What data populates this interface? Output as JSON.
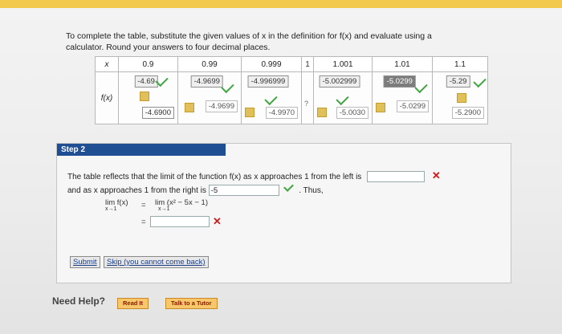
{
  "intro_line1": "To complete the table, substitute the given values of x in the definition for f(x) and evaluate using a",
  "intro_line2": "calculator. Round your answers to four decimal places.",
  "table": {
    "x_label": "x",
    "fx_label": "f(x)",
    "x_values": [
      "0.9",
      "0.99",
      "0.999",
      "1",
      "1.001",
      "1.01",
      "1.1"
    ],
    "answers_top": [
      "-4.69",
      "-4.9699",
      "-4.996999",
      "?",
      "-5.002999",
      "-5.0299",
      "-5.29"
    ],
    "answers_bottom": [
      "-4.6900",
      "-4.9699",
      "-4.9970",
      "",
      "-5.0030",
      "-5.0299",
      "-5.2900"
    ]
  },
  "step2": {
    "label": "Step 2",
    "line1": "The table reflects that the limit of the function f(x) as x approaches 1 from the left is",
    "line2a": "and as x approaches 1 from the right is",
    "right_value": "-5",
    "thus": ". Thus,",
    "lim_lhs": "lim f(x)",
    "lim_rhs": "lim (x² − 5x − 1)",
    "lim_sub": "x→1",
    "equals": "="
  },
  "buttons": {
    "submit": "Submit",
    "skip": "Skip (you cannot come back)"
  },
  "help": {
    "title": "Need Help?",
    "read": "Read It",
    "tutor": "Talk to a Tutor"
  },
  "colors": {
    "step_bar": "#1f4e93",
    "check": "#3fa53f",
    "error": "#d01a1a"
  }
}
